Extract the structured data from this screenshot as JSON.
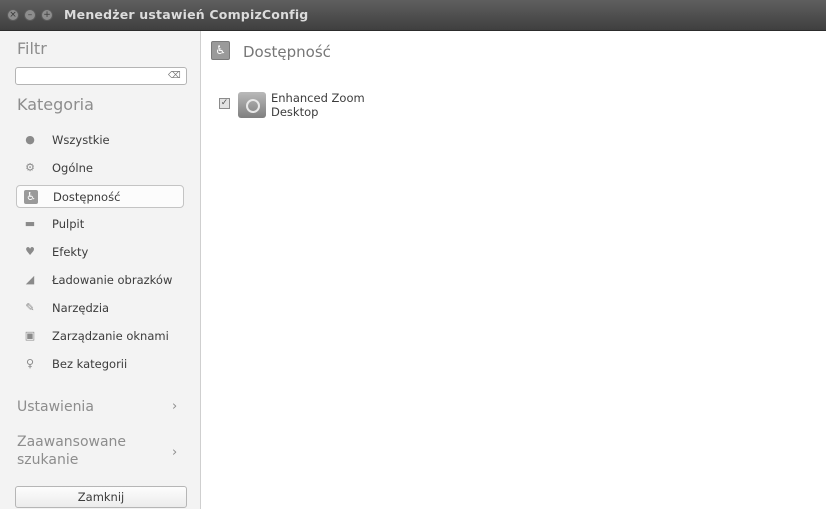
{
  "window": {
    "title": "Menedżer ustawień CompizConfig",
    "buttons": [
      "close-icon",
      "minimize-icon",
      "maximize-icon"
    ]
  },
  "sidebar": {
    "filter_heading": "Filtr",
    "filter_value": "",
    "category_heading": "Kategoria",
    "categories": [
      {
        "label": "Wszystkie",
        "icon": "globe-icon",
        "selected": false
      },
      {
        "label": "Ogólne",
        "icon": "gear-icon",
        "selected": false
      },
      {
        "label": "Dostępność",
        "icon": "accessibility-icon",
        "selected": true
      },
      {
        "label": "Pulpit",
        "icon": "desktop-icon",
        "selected": false
      },
      {
        "label": "Efekty",
        "icon": "effects-icon",
        "selected": false
      },
      {
        "label": "Ładowanie obrazków",
        "icon": "image-loading-icon",
        "selected": false
      },
      {
        "label": "Narzędzia",
        "icon": "tools-icon",
        "selected": false
      },
      {
        "label": "Zarządzanie oknami",
        "icon": "window-management-icon",
        "selected": false
      },
      {
        "label": "Bez kategorii",
        "icon": "uncategorized-icon",
        "selected": false
      }
    ],
    "settings_label": "Ustawienia",
    "advanced_search_line1": "Zaawansowane",
    "advanced_search_line2": "szukanie",
    "close_button": "Zamknij"
  },
  "main": {
    "title": "Dostępność",
    "plugins": [
      {
        "name_line1": "Enhanced Zoom",
        "name_line2": "Desktop",
        "enabled": true
      }
    ]
  }
}
